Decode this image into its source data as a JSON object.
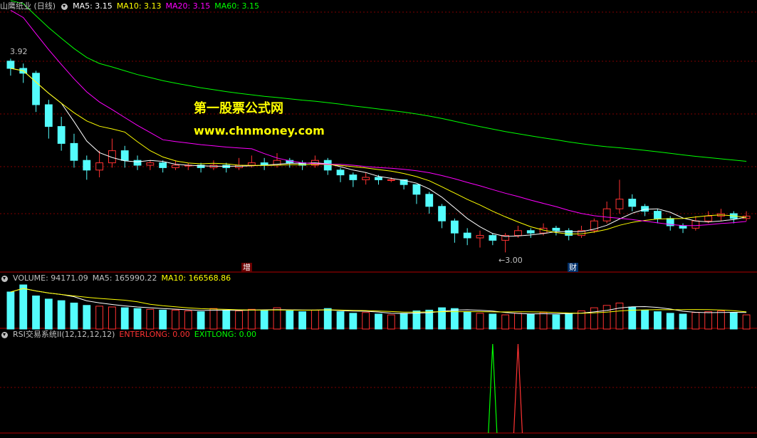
{
  "main_panel": {
    "stock_label": "山鹰纸业 (日线)",
    "indicators": [
      {
        "label": "MA5: 3.15",
        "color": "#ffffff"
      },
      {
        "label": "MA10: 3.13",
        "color": "#ffff00"
      },
      {
        "label": "MA20: 3.15",
        "color": "#ff00ff"
      },
      {
        "label": "MA60: 3.15",
        "color": "#00ff00"
      }
    ],
    "high_label": "3.92",
    "low_label": "←3.00",
    "event_tags": [
      {
        "label": "增",
        "color": "#ffffff",
        "bg": "#6a0000"
      },
      {
        "label": "财",
        "color": "#ffffff",
        "bg": "#00306a"
      }
    ]
  },
  "watermark": {
    "line1": "第一股票公式网",
    "line2": "www.chnmoney.com"
  },
  "volume_panel": {
    "title": "VOLUME: 94171.09",
    "ma5": "MA5: 165990.22",
    "ma10": "MA10: 166568.86"
  },
  "rsi_panel": {
    "title": "RSI交易系统II(12,12,12,12)",
    "enterlong": "ENTERLONG: 0.00",
    "exitlong": "EXITLONG: 0.00"
  },
  "colors": {
    "up": "#ff3232",
    "down": "#54fcfc",
    "grid": "#800000",
    "ma5": "#ffffff",
    "ma10": "#ffff00",
    "ma20": "#ff00ff",
    "ma60": "#00ff00",
    "enter": "#ff3232",
    "exit": "#00ff00"
  },
  "chart_data": {
    "type": "candlestick",
    "price_ylim": [
      3.0,
      3.92
    ],
    "candles": [
      {
        "o": 3.79,
        "c": 3.76,
        "h": 3.8,
        "l": 3.73
      },
      {
        "o": 3.76,
        "c": 3.74,
        "h": 3.78,
        "l": 3.7
      },
      {
        "o": 3.74,
        "c": 3.61,
        "h": 3.75,
        "l": 3.58
      },
      {
        "o": 3.61,
        "c": 3.52,
        "h": 3.63,
        "l": 3.47
      },
      {
        "o": 3.52,
        "c": 3.45,
        "h": 3.56,
        "l": 3.42
      },
      {
        "o": 3.45,
        "c": 3.38,
        "h": 3.49,
        "l": 3.35
      },
      {
        "o": 3.38,
        "c": 3.34,
        "h": 3.4,
        "l": 3.3
      },
      {
        "o": 3.34,
        "c": 3.37,
        "h": 3.42,
        "l": 3.31
      },
      {
        "o": 3.37,
        "c": 3.42,
        "h": 3.47,
        "l": 3.35
      },
      {
        "o": 3.42,
        "c": 3.38,
        "h": 3.44,
        "l": 3.35
      },
      {
        "o": 3.38,
        "c": 3.36,
        "h": 3.4,
        "l": 3.34
      },
      {
        "o": 3.36,
        "c": 3.37,
        "h": 3.38,
        "l": 3.34
      },
      {
        "o": 3.37,
        "c": 3.35,
        "h": 3.38,
        "l": 3.33
      },
      {
        "o": 3.35,
        "c": 3.36,
        "h": 3.38,
        "l": 3.34
      },
      {
        "o": 3.36,
        "c": 3.36,
        "h": 3.37,
        "l": 3.34
      },
      {
        "o": 3.36,
        "c": 3.35,
        "h": 3.37,
        "l": 3.33
      },
      {
        "o": 3.35,
        "c": 3.36,
        "h": 3.38,
        "l": 3.34
      },
      {
        "o": 3.36,
        "c": 3.35,
        "h": 3.37,
        "l": 3.33
      },
      {
        "o": 3.35,
        "c": 3.36,
        "h": 3.39,
        "l": 3.34
      },
      {
        "o": 3.36,
        "c": 3.37,
        "h": 3.4,
        "l": 3.35
      },
      {
        "o": 3.37,
        "c": 3.36,
        "h": 3.39,
        "l": 3.34
      },
      {
        "o": 3.36,
        "c": 3.38,
        "h": 3.41,
        "l": 3.35
      },
      {
        "o": 3.38,
        "c": 3.37,
        "h": 3.39,
        "l": 3.35
      },
      {
        "o": 3.37,
        "c": 3.36,
        "h": 3.38,
        "l": 3.34
      },
      {
        "o": 3.36,
        "c": 3.38,
        "h": 3.4,
        "l": 3.35
      },
      {
        "o": 3.38,
        "c": 3.34,
        "h": 3.39,
        "l": 3.32
      },
      {
        "o": 3.34,
        "c": 3.32,
        "h": 3.35,
        "l": 3.29
      },
      {
        "o": 3.32,
        "c": 3.3,
        "h": 3.33,
        "l": 3.27
      },
      {
        "o": 3.3,
        "c": 3.31,
        "h": 3.33,
        "l": 3.28
      },
      {
        "o": 3.31,
        "c": 3.3,
        "h": 3.32,
        "l": 3.28
      },
      {
        "o": 3.3,
        "c": 3.3,
        "h": 3.31,
        "l": 3.29
      },
      {
        "o": 3.3,
        "c": 3.28,
        "h": 3.3,
        "l": 3.26
      },
      {
        "o": 3.28,
        "c": 3.24,
        "h": 3.28,
        "l": 3.2
      },
      {
        "o": 3.24,
        "c": 3.19,
        "h": 3.25,
        "l": 3.16
      },
      {
        "o": 3.19,
        "c": 3.13,
        "h": 3.2,
        "l": 3.1
      },
      {
        "o": 3.13,
        "c": 3.08,
        "h": 3.14,
        "l": 3.04
      },
      {
        "o": 3.08,
        "c": 3.06,
        "h": 3.1,
        "l": 3.03
      },
      {
        "o": 3.06,
        "c": 3.07,
        "h": 3.09,
        "l": 3.02
      },
      {
        "o": 3.07,
        "c": 3.05,
        "h": 3.08,
        "l": 3.03
      },
      {
        "o": 3.05,
        "c": 3.07,
        "h": 3.08,
        "l": 3.0
      },
      {
        "o": 3.07,
        "c": 3.09,
        "h": 3.11,
        "l": 3.06
      },
      {
        "o": 3.09,
        "c": 3.08,
        "h": 3.1,
        "l": 3.06
      },
      {
        "o": 3.08,
        "c": 3.1,
        "h": 3.12,
        "l": 3.07
      },
      {
        "o": 3.1,
        "c": 3.09,
        "h": 3.11,
        "l": 3.07
      },
      {
        "o": 3.09,
        "c": 3.07,
        "h": 3.1,
        "l": 3.05
      },
      {
        "o": 3.07,
        "c": 3.09,
        "h": 3.11,
        "l": 3.06
      },
      {
        "o": 3.09,
        "c": 3.13,
        "h": 3.14,
        "l": 3.08
      },
      {
        "o": 3.13,
        "c": 3.18,
        "h": 3.21,
        "l": 3.12
      },
      {
        "o": 3.18,
        "c": 3.22,
        "h": 3.3,
        "l": 3.16
      },
      {
        "o": 3.22,
        "c": 3.19,
        "h": 3.24,
        "l": 3.17
      },
      {
        "o": 3.19,
        "c": 3.17,
        "h": 3.2,
        "l": 3.15
      },
      {
        "o": 3.17,
        "c": 3.14,
        "h": 3.18,
        "l": 3.12
      },
      {
        "o": 3.14,
        "c": 3.11,
        "h": 3.15,
        "l": 3.09
      },
      {
        "o": 3.11,
        "c": 3.1,
        "h": 3.12,
        "l": 3.08
      },
      {
        "o": 3.1,
        "c": 3.13,
        "h": 3.15,
        "l": 3.09
      },
      {
        "o": 3.13,
        "c": 3.15,
        "h": 3.17,
        "l": 3.12
      },
      {
        "o": 3.15,
        "c": 3.16,
        "h": 3.18,
        "l": 3.13
      },
      {
        "o": 3.16,
        "c": 3.14,
        "h": 3.17,
        "l": 3.12
      },
      {
        "o": 3.14,
        "c": 3.15,
        "h": 3.17,
        "l": 3.13
      }
    ],
    "volumes": [
      470,
      560,
      420,
      380,
      360,
      330,
      300,
      290,
      280,
      270,
      260,
      250,
      240,
      240,
      230,
      220,
      260,
      240,
      230,
      250,
      240,
      270,
      230,
      220,
      240,
      260,
      220,
      200,
      210,
      190,
      180,
      200,
      230,
      240,
      270,
      260,
      220,
      200,
      190,
      180,
      200,
      190,
      210,
      180,
      200,
      230,
      270,
      300,
      330,
      280,
      240,
      220,
      200,
      190,
      210,
      220,
      230,
      210,
      180
    ],
    "enterlong": {
      "x_index": 40,
      "value": 1
    },
    "exitlong": {
      "x_index": 38,
      "value": 1
    }
  }
}
